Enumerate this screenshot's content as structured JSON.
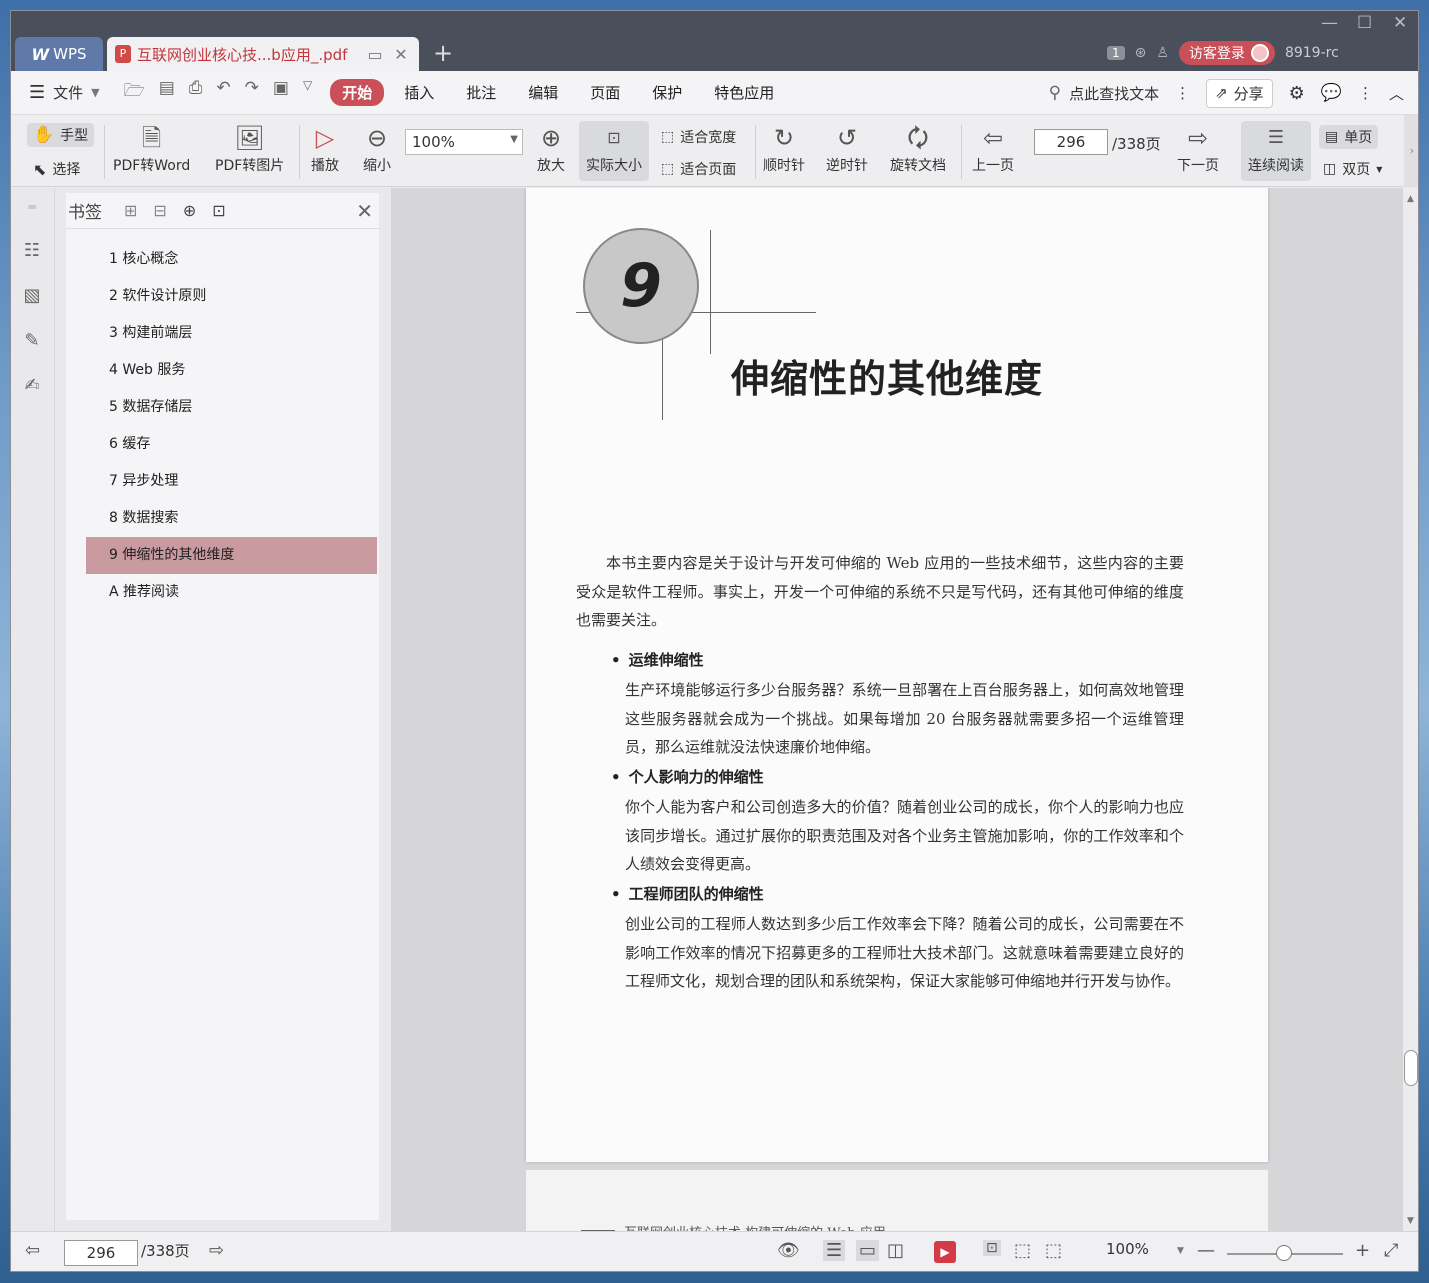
{
  "titlebar": {
    "app_tab": "WPS",
    "doc_tab": "互联网创业核心技...b应用_.pdf",
    "badge": "1",
    "login": "访客登录",
    "user_id": "8919-rc"
  },
  "menubar": {
    "file": "文件",
    "tabs": [
      "开始",
      "插入",
      "批注",
      "编辑",
      "页面",
      "保护",
      "特色应用"
    ],
    "search": "点此查找文本",
    "share": "分享"
  },
  "ribbon": {
    "hand": "手型",
    "select": "选择",
    "pdf_to_word": "PDF转Word",
    "pdf_to_image": "PDF转图片",
    "play": "播放",
    "zoom_out": "缩小",
    "zoom_value": "100%",
    "zoom_in": "放大",
    "actual_size": "实际大小",
    "fit_width": "适合宽度",
    "fit_page": "适合页面",
    "clockwise": "顺时针",
    "counterclockwise": "逆时针",
    "rotate_doc": "旋转文档",
    "prev_page": "上一页",
    "page_value": "296",
    "page_total": "/338页",
    "next_page": "下一页",
    "continuous": "连续阅读",
    "single": "单页",
    "double": "双页"
  },
  "bookmarks": {
    "title": "书签",
    "items": [
      "1 核心概念",
      "2 软件设计原则",
      "3 构建前端层",
      "4 Web 服务",
      "5 数据存储层",
      "6 缓存",
      "7 异步处理",
      "8 数据搜索",
      "9 伸缩性的其他维度",
      "A 推荐阅读"
    ]
  },
  "page": {
    "chapter_number": "9",
    "chapter_title": "伸缩性的其他维度",
    "intro": "本书主要内容是关于设计与开发可伸缩的 Web 应用的一些技术细节，这些内容的主要受众是软件工程师。事实上，开发一个可伸缩的系统不只是写代码，还有其他可伸缩的维度也需要关注。",
    "bullets": [
      {
        "title": "运维伸缩性",
        "text": "生产环境能够运行多少台服务器？系统一旦部署在上百台服务器上，如何高效地管理这些服务器就会成为一个挑战。如果每增加 20 台服务器就需要多招一个运维管理员，那么运维就没法快速廉价地伸缩。"
      },
      {
        "title": "个人影响力的伸缩性",
        "text": "你个人能为客户和公司创造多大的价值？随着创业公司的成长，你个人的影响力也应该同步增长。通过扩展你的职责范围及对各个业务主管施加影响，你的工作效率和个人绩效会变得更高。"
      },
      {
        "title": "工程师团队的伸缩性",
        "text": "创业公司的工程师人数达到多少后工作效率会下降？随着公司的成长，公司需要在不影响工作效率的情况下招募更多的工程师壮大技术部门。这就意味着需要建立良好的工程师文化，规划合理的团队和系统架构，保证大家能够可伸缩地并行开发与协作。"
      }
    ],
    "next_page_header": "互联网创业核心技术  构建可伸缩的 Web 应用"
  },
  "statusbar": {
    "page_value": "296",
    "page_total": "/338页",
    "zoom": "100%"
  }
}
